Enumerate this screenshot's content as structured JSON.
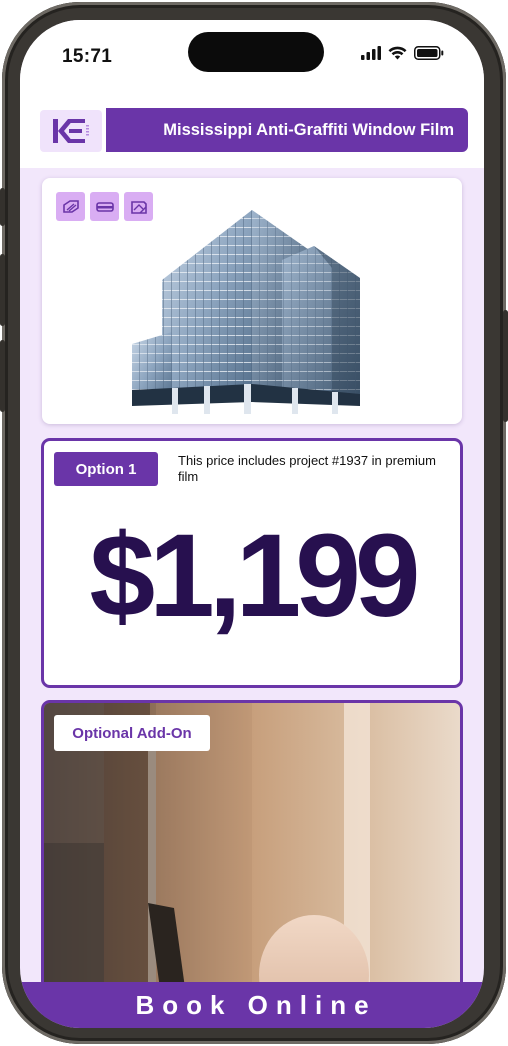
{
  "status_bar": {
    "time": "15:71",
    "icons": [
      "cellular-signal-icon",
      "wifi-icon",
      "battery-icon"
    ]
  },
  "header": {
    "logo_alt": "KE",
    "title": "Mississippi Anti-Graffiti Window Film"
  },
  "hero": {
    "feature_icons": [
      "window-film-icon",
      "strip-film-icon",
      "graffiti-film-icon"
    ],
    "image": "office-building-image"
  },
  "option": {
    "badge": "Option 1",
    "description": "This price includes project #1937 in premium film",
    "price": "$1,199"
  },
  "addon": {
    "badge": "Optional Add-On",
    "image": "film-application-photo"
  },
  "footer": {
    "cta": "Book Online"
  },
  "colors": {
    "brand_purple": "#6a35a8",
    "price_text": "#27104f",
    "page_bg": "#f2e7fb",
    "icon_bg": "#d9adf3"
  }
}
